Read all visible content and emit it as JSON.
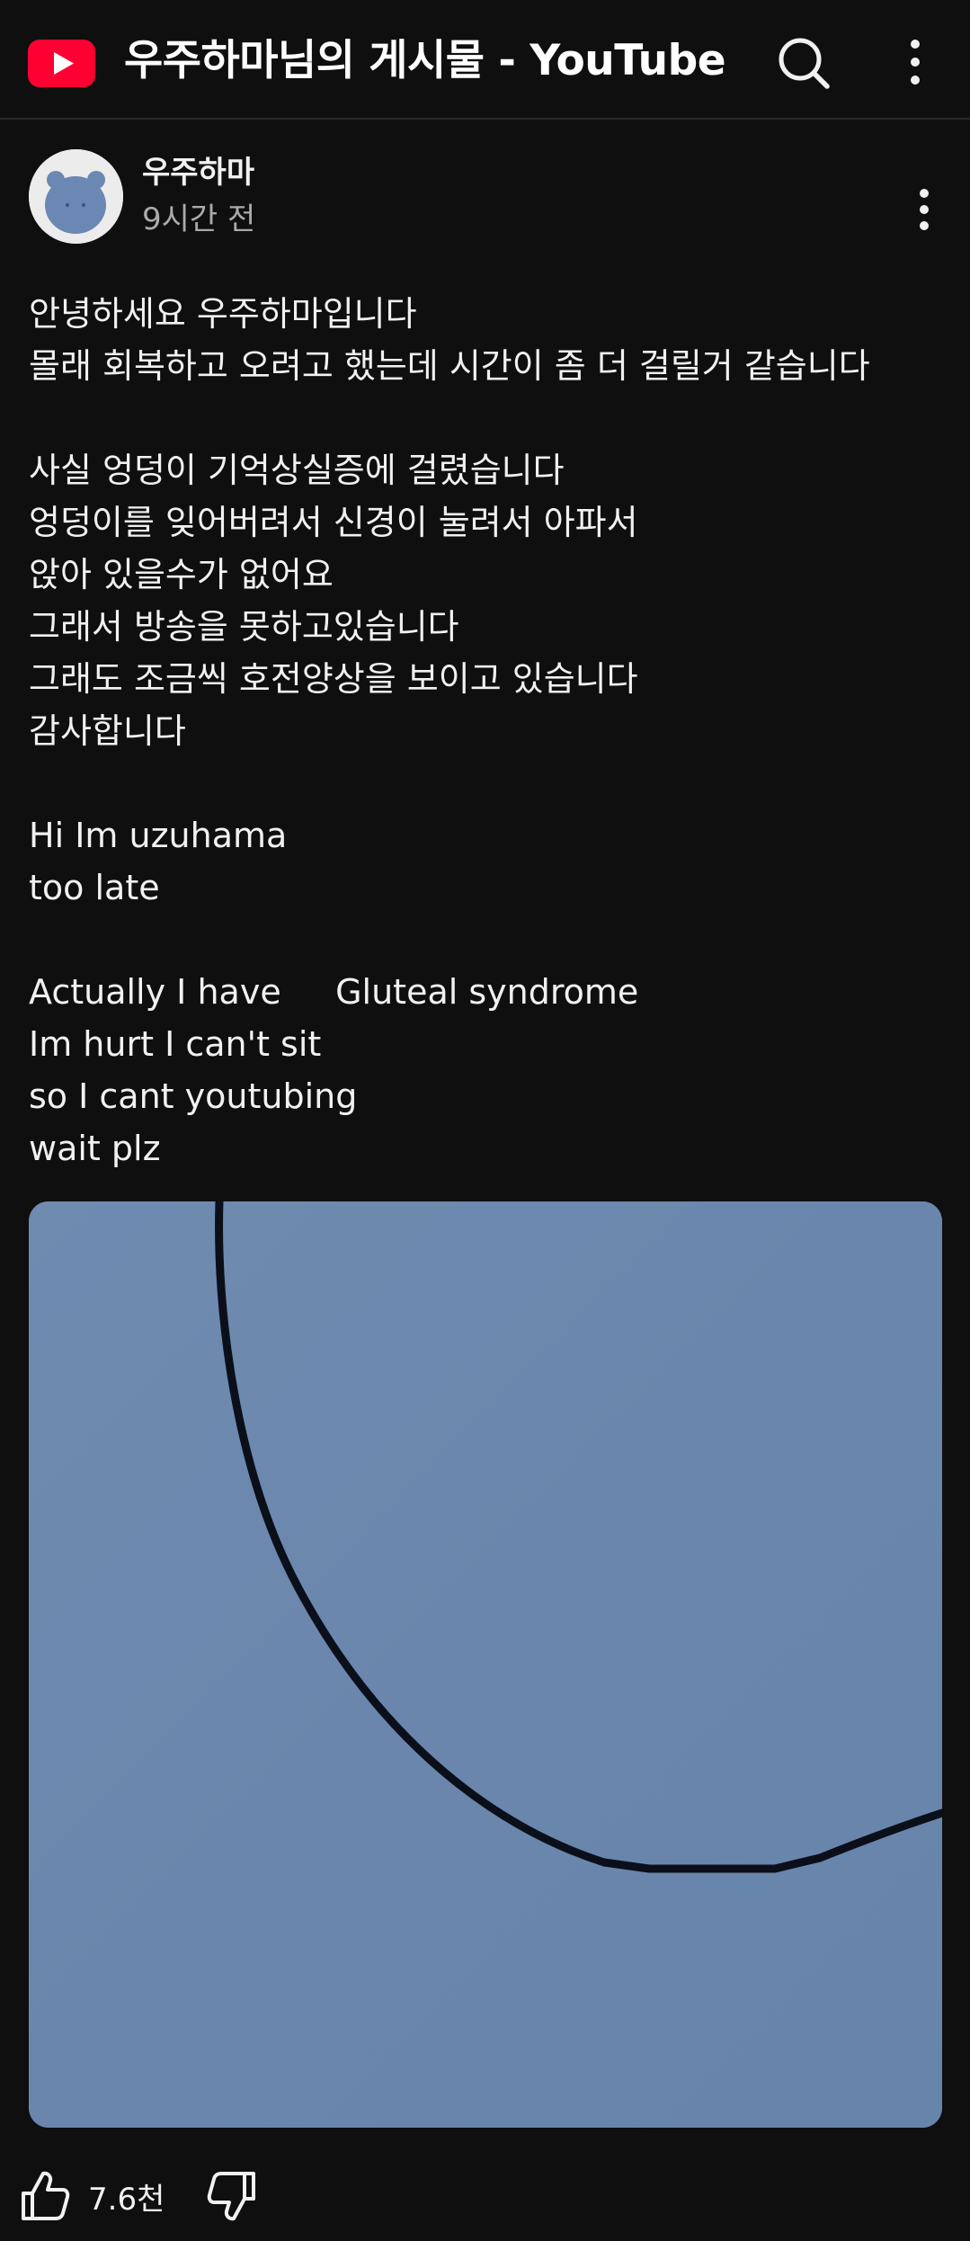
{
  "header": {
    "title": "우주하마님의 게시물 - YouTube",
    "logo_icon": "youtube-logo",
    "search_icon": "search-icon",
    "more_icon": "more-vert-icon",
    "logo_color": "#ff0033"
  },
  "post": {
    "channel_name": "우주하마",
    "time_ago": "9시간 전",
    "more_icon": "more-vert-icon",
    "body_lines": [
      "안녕하세요 우주하마입니다",
      "몰래 회복하고 오려고 했는데 시간이 좀 더 걸릴거 같습니다",
      "",
      "사실 엉덩이 기억상실증에 걸렸습니다",
      "엉덩이를 잊어버려서 신경이 눌려서 아파서",
      "앉아 있을수가 없어요",
      "그래서 방송을 못하고있습니다",
      "그래도 조금씩 호전양상을 보이고 있습니다",
      "감사합니다",
      "",
      "Hi Im uzuhama",
      "too late",
      "",
      "Actually I have     Gluteal syndrome",
      "Im hurt I can't sit",
      "so I cant youtubing",
      "wait plz"
    ],
    "image_bg_color": "#6b87ad"
  },
  "actions": {
    "like_count": "7.6천",
    "like_icon": "thumbs-up-icon",
    "dislike_icon": "thumbs-down-icon"
  }
}
